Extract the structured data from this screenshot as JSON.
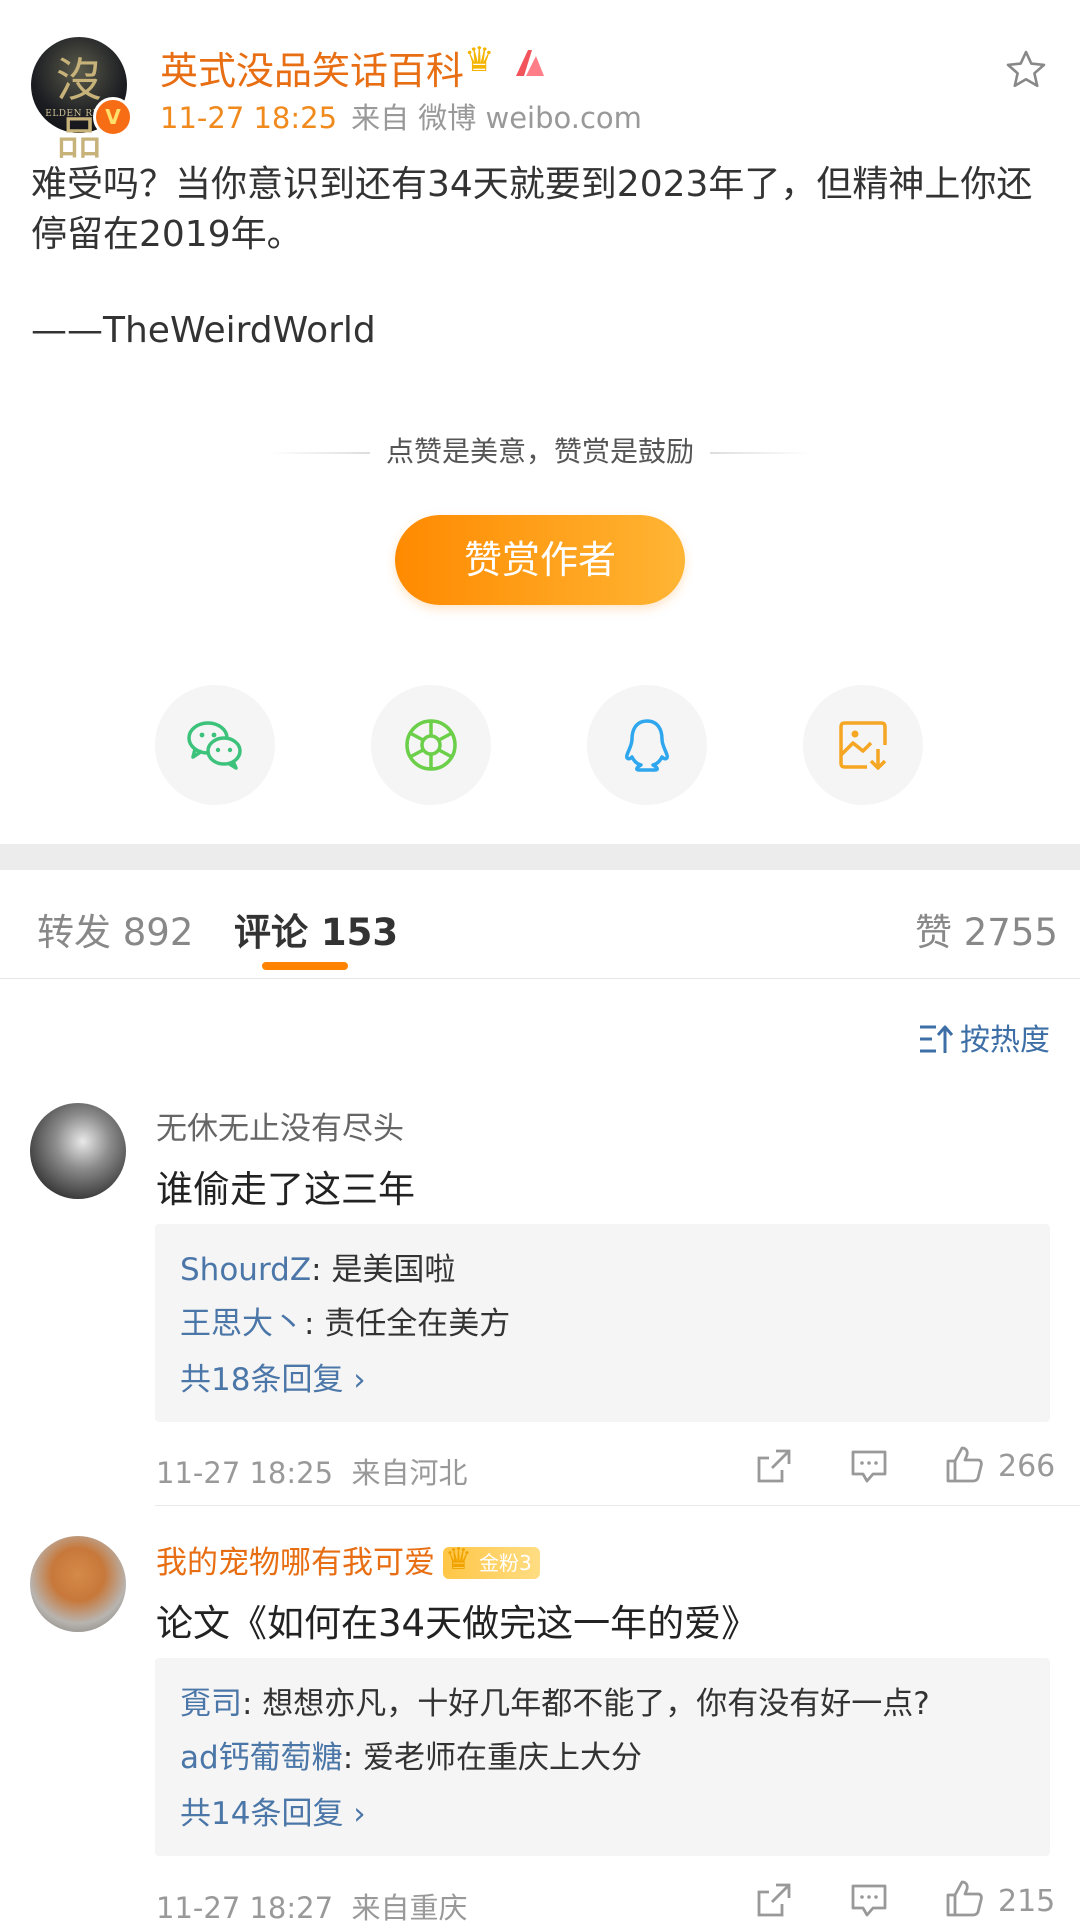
{
  "post": {
    "author": "英式没品笑话百科",
    "avatar_text": "沒品",
    "avatar_subtext": "ELDEN RING",
    "verified_badge": "V",
    "time": "11-27 18:25",
    "source": "来自 微博 weibo.com",
    "text": "难受吗？当你意识到还有34天就要到2023年了，但精神上你还停留在2019年。",
    "signature": "——TheWeirdWorld"
  },
  "reward": {
    "slogan": "点赞是美意，赞赏是鼓励",
    "button": "赞赏作者"
  },
  "share": {
    "icons": [
      "wechat-icon",
      "moments-icon",
      "qq-icon",
      "save-image-icon"
    ]
  },
  "tabs": {
    "repost": "转发 892",
    "comments": "评论 153",
    "likes": "赞 2755"
  },
  "sort_label": "按热度",
  "comments": [
    {
      "user": "无休无止没有尽头",
      "text": "谁偷走了这三年",
      "replies": [
        {
          "user": "ShourdZ",
          "text": ": 是美国啦"
        },
        {
          "user": "王思大丶",
          "text": ": 责任全在美方"
        }
      ],
      "more": "共18条回复 ›",
      "time": "11-27 18:25",
      "location": "来自河北",
      "likes": "266"
    },
    {
      "user": "我的宠物哪有我可爱",
      "badge": "金粉3",
      "text": "论文《如何在34天做完这一年的爱》",
      "replies": [
        {
          "user": "覔司",
          "text": ": 想想亦凡，十好几年都不能了，你有没有好一点?"
        },
        {
          "user": "ad钙葡萄糖",
          "text": ": 爱老师在重庆上大分"
        }
      ],
      "more": "共14条回复 ›",
      "time": "11-27 18:27",
      "location": "来自重庆",
      "likes": "215"
    }
  ],
  "colors": {
    "accent_orange": "#ff8200",
    "author_orange": "#e86e13",
    "link_blue": "#4b76a8"
  }
}
